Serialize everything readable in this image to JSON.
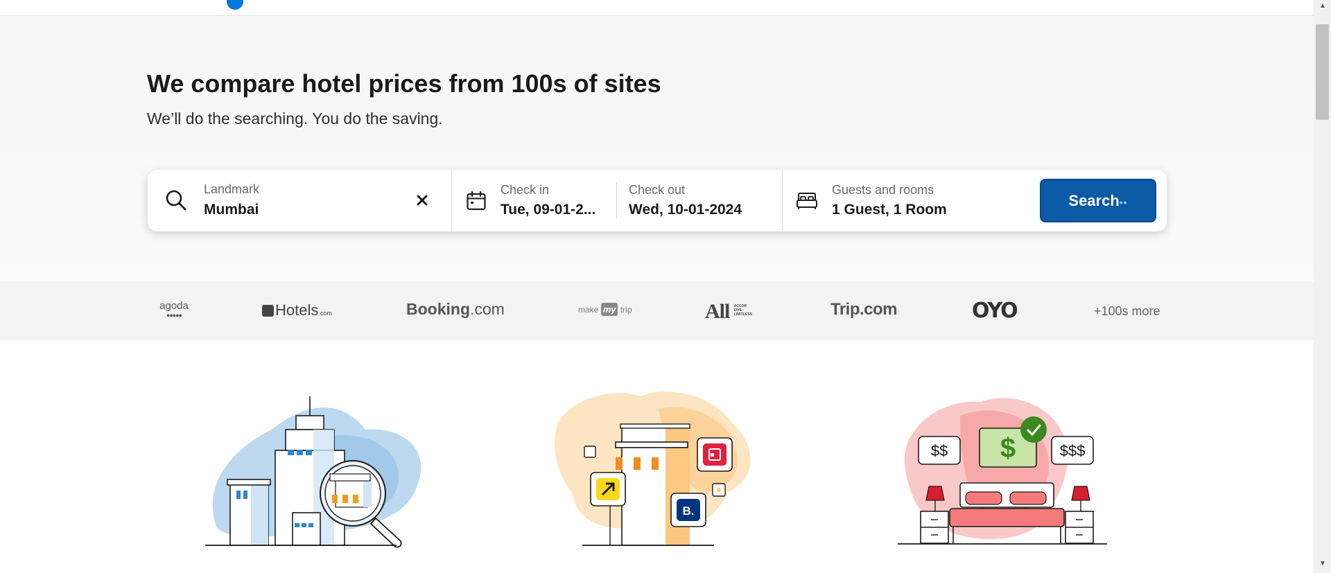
{
  "hero": {
    "title": "We compare hotel prices from 100s of sites",
    "subtitle": "We’ll do the searching. You do the saving."
  },
  "search": {
    "landmark_label": "Landmark",
    "landmark_value": "Mumbai",
    "checkin_label": "Check in",
    "checkin_value": "Tue, 09-01-2...",
    "checkout_label": "Check out",
    "checkout_value": "Wed, 10-01-2024",
    "guests_label": "Guests and rooms",
    "guests_value": "1 Guest, 1 Room",
    "button_label": "Search",
    "button_dots": "••"
  },
  "partners": {
    "agoda": "agoda",
    "agoda_dots": "●●●●●",
    "hotels": "Hotels",
    "hotels_suffix": ".com",
    "booking": "Booking",
    "booking_suffix": ".com",
    "mmt_make": "make",
    "mmt_my": "my",
    "mmt_trip": "trip",
    "accor_all": "All",
    "accor_sub": [
      "ACCOR",
      "LIVE",
      "LIMITLESS"
    ],
    "trip": "Trip.com",
    "oyo": "OYO",
    "more": "+100s more"
  },
  "illustrations": {
    "price_low": "$$",
    "price_best": "$",
    "price_high": "$$$",
    "booking_badge": "B."
  },
  "colors": {
    "accent": "#0a5aa6",
    "brand_dot": "#0077d9",
    "hero_bg": "#f6f6f6",
    "partner_band": "#f3f3f3"
  },
  "icons": {
    "landmark": "search-icon",
    "clear": "close-icon",
    "dates": "calendar-icon",
    "guests": "bed-icon"
  }
}
